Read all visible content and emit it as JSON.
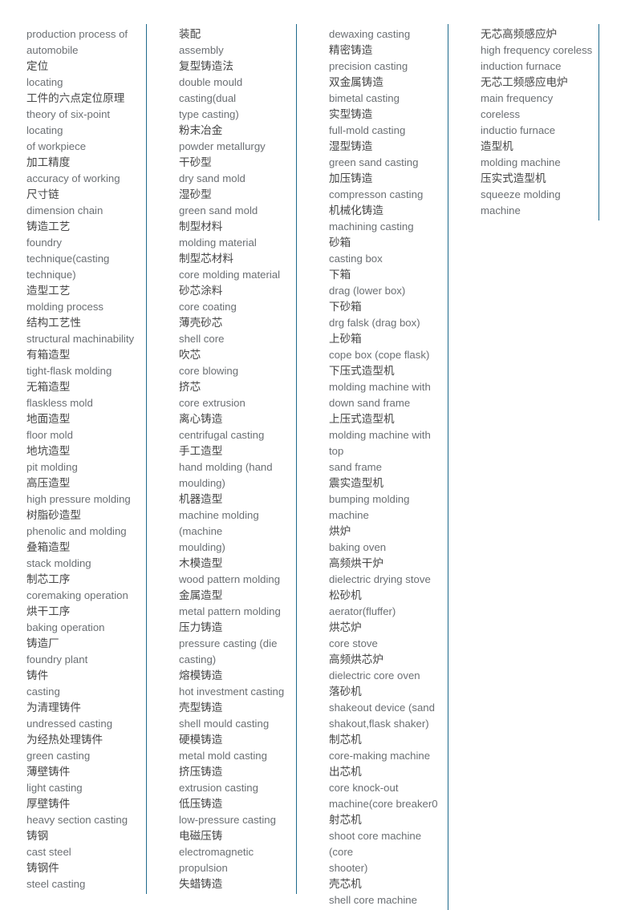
{
  "document": {
    "title": "Casting and foundry terminology glossary (Chinese-English)",
    "layout": "four-column-term-list",
    "text_colors": {
      "chinese": "#464646",
      "english": "#6b6f73",
      "column_rule": "#1f6a8c"
    }
  },
  "columns": [
    {
      "id": "column-1",
      "entries": [
        "production process of",
        "automobile",
        "定位",
        "locating",
        "工件的六点定位原理",
        "theory of six-point locating",
        "of workpiece",
        "加工精度",
        "accuracy of working",
        "尺寸链",
        "dimension chain",
        "铸造工艺",
        "foundry technique(casting",
        "technique)",
        "造型工艺",
        "molding process",
        "结构工艺性",
        "structural machinability",
        "有箱造型",
        "tight-flask molding",
        "无箱造型",
        "flaskless mold",
        "地面造型",
        "floor mold",
        "地坑造型",
        "pit molding",
        "高压造型",
        "high pressure molding",
        "树脂砂造型",
        "phenolic and molding",
        "叠箱造型",
        "stack molding",
        "制芯工序",
        "coremaking operation",
        "烘干工序",
        "baking operation",
        "铸造厂",
        "foundry plant",
        "铸件",
        "casting",
        "为清理铸件",
        "undressed casting",
        "为经热处理铸件",
        "green casting",
        "薄壁铸件",
        "light casting",
        "厚壁铸件",
        "heavy section casting",
        "铸钢",
        "cast steel",
        "铸钢件",
        "steel casting"
      ]
    },
    {
      "id": "column-2",
      "entries": [
        "装配",
        "assembly",
        "复型铸造法",
        "double mould casting(dual",
        "type casting)",
        "粉末冶金",
        "powder metallurgy",
        "干砂型",
        "dry sand mold",
        "湿砂型",
        "green sand mold",
        "制型材料",
        "molding material",
        "制型芯材料",
        "core molding material",
        "砂芯涂料",
        "core coating",
        "薄壳砂芯",
        "shell core",
        "吹芯",
        "core blowing",
        "挤芯",
        "core extrusion",
        "离心铸造",
        "centrifugal casting",
        "手工造型",
        "hand molding (hand",
        "moulding)",
        "机器造型",
        "machine molding (machine",
        "moulding)",
        "木模造型",
        "wood pattern molding",
        "金属造型",
        "metal pattern molding",
        "压力铸造",
        "pressure casting (die",
        "casting)",
        "熔模铸造",
        "hot investment casting",
        "壳型铸造",
        "shell mould casting",
        "硬模铸造",
        "metal mold casting",
        "挤压铸造",
        "extrusion casting",
        "低压铸造",
        "low-pressure casting",
        "电磁压铸",
        "electromagnetic",
        "propulsion",
        "失蜡铸造"
      ]
    },
    {
      "id": "column-3",
      "entries": [
        "dewaxing casting",
        "精密铸造",
        "precision casting",
        "双金属铸造",
        "bimetal casting",
        "实型铸造",
        "full-mold casting",
        "湿型铸造",
        "green sand casting",
        "加压铸造",
        "compresson casting",
        "机械化铸造",
        "machining casting",
        "砂箱",
        "casting box",
        "下箱",
        "drag (lower box)",
        "下砂箱",
        "drg falsk (drag box)",
        "上砂箱",
        "cope box (cope flask)",
        "下压式造型机",
        "molding machine with",
        "down sand frame",
        "上压式造型机",
        "molding machine with top",
        "sand frame",
        "震实造型机",
        "bumping molding machine",
        "烘炉",
        "baking oven",
        "高频烘干炉",
        "dielectric drying stove",
        "松砂机",
        "aerator(fluffer)",
        "烘芯炉",
        "core stove",
        "高频烘芯炉",
        "dielectric core oven",
        "落砂机",
        "shakeout device (sand",
        "shakout,flask shaker)",
        "制芯机",
        "core-making machine",
        "出芯机",
        "core knock-out",
        "machine(core breaker0",
        "射芯机",
        "shoot core machine (core",
        "shooter)",
        "壳芯机",
        "shell core machine"
      ]
    },
    {
      "id": "column-4",
      "entries": [
        "无芯高频感应炉",
        "high frequency coreless",
        "induction furnace",
        "无芯工频感应电炉",
        "main frequency coreless",
        "inductio furnace",
        "造型机",
        "molding machine",
        "压实式造型机",
        "squeeze molding machine"
      ]
    }
  ]
}
